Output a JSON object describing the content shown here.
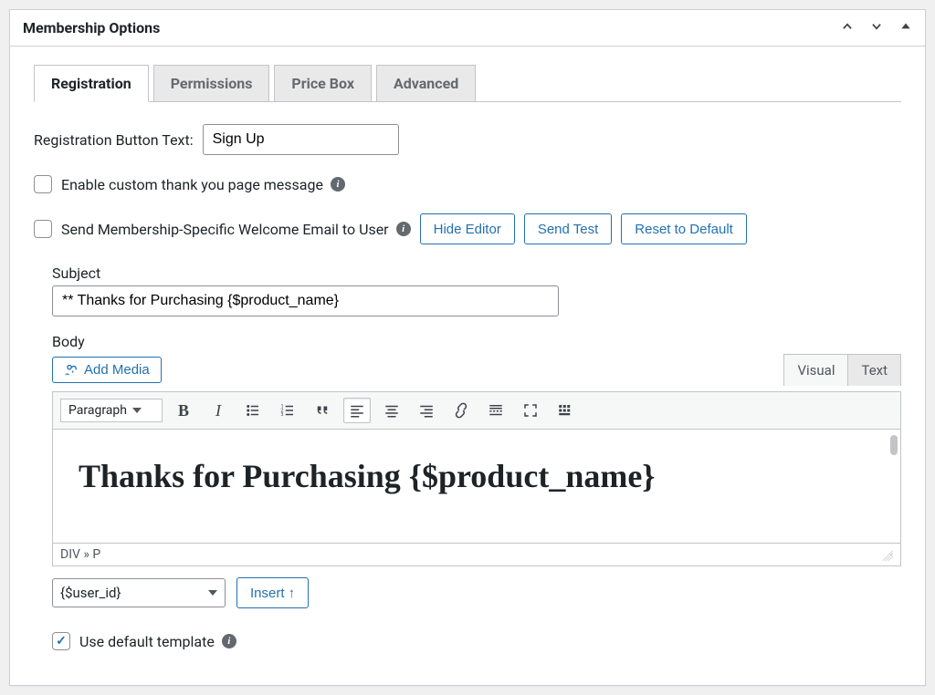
{
  "panel": {
    "title": "Membership Options"
  },
  "tabs": {
    "registration": "Registration",
    "permissions": "Permissions",
    "pricebox": "Price Box",
    "advanced": "Advanced"
  },
  "registration_button_text": {
    "label": "Registration Button Text:",
    "value": "Sign Up"
  },
  "custom_thank_you": {
    "label": "Enable custom thank you page message"
  },
  "welcome_email": {
    "label": "Send Membership-Specific Welcome Email to User",
    "buttons": {
      "hide_editor": "Hide Editor",
      "send_test": "Send Test",
      "reset": "Reset to Default"
    }
  },
  "subject": {
    "label": "Subject",
    "value": "** Thanks for Purchasing {$product_name}"
  },
  "body": {
    "label": "Body",
    "add_media": "Add Media",
    "tabs": {
      "visual": "Visual",
      "text": "Text"
    },
    "format_select": "Paragraph",
    "content_heading": "Thanks for Purchasing {$product_name}",
    "path": "DIV » P"
  },
  "insert": {
    "selected": "{$user_id}",
    "button": "Insert ↑"
  },
  "use_default_template": {
    "label": "Use default template"
  }
}
